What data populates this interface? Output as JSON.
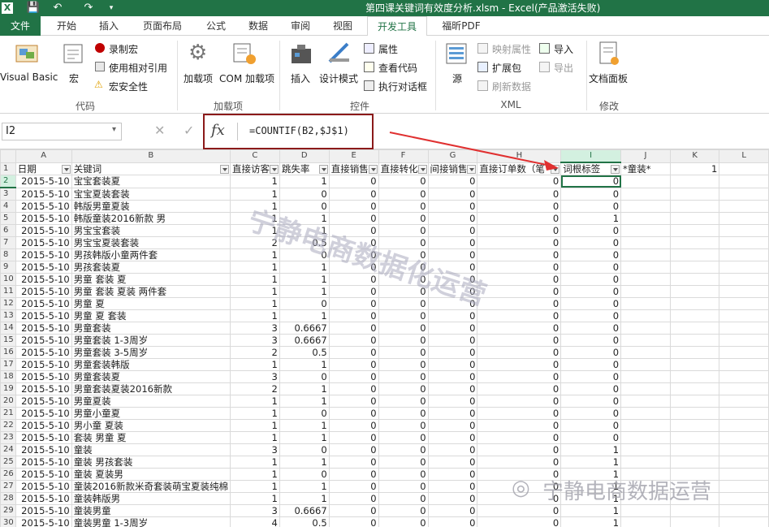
{
  "titlebar": {
    "title": "第四课关键词有效度分析.xlsm - Excel(产品激活失败)",
    "app_icon": "X"
  },
  "tabs": [
    "文件",
    "开始",
    "插入",
    "页面布局",
    "公式",
    "数据",
    "审阅",
    "视图",
    "开发工具",
    "福昕PDF"
  ],
  "ribbon": {
    "vb": "Visual Basic",
    "macro": "宏",
    "record": "录制宏",
    "relative": "使用相对引用",
    "security": "宏安全性",
    "g_code": "代码",
    "addin": "加载项",
    "com": "COM 加载项",
    "g_addin": "加载项",
    "insert": "插入",
    "design": "设计模式",
    "props": "属性",
    "viewcode": "查看代码",
    "rundialog": "执行对话框",
    "g_ctrl": "控件",
    "source": "源",
    "mapprops": "映射属性",
    "expand": "扩展包",
    "refresh": "刷新数据",
    "import": "导入",
    "export": "导出",
    "g_xml": "XML",
    "docpanel": "文档面板",
    "g_mod": "修改"
  },
  "formula_bar": {
    "cell": "I2",
    "formula": "=COUNTIF(B2,$J$1)",
    "fx": "fx",
    "cancel": "✕",
    "confirm": "✓"
  },
  "columns": [
    "A",
    "B",
    "C",
    "D",
    "E",
    "F",
    "G",
    "H",
    "I",
    "J",
    "K",
    "L"
  ],
  "headers": [
    "日期",
    "关键词",
    "直接访客",
    "跳失率",
    "直接销售",
    "直接转化",
    "间接销售",
    "直接订单数（笔",
    "词根标签",
    "*童装*",
    "1",
    ""
  ],
  "rows": [
    [
      "2015-5-10",
      "宝宝套装夏",
      "1",
      "1",
      "0",
      "0",
      "0",
      "0",
      "0"
    ],
    [
      "2015-5-10",
      "宝宝夏装套装",
      "1",
      "0",
      "0",
      "0",
      "0",
      "0",
      "0"
    ],
    [
      "2015-5-10",
      "韩版男童夏装",
      "1",
      "0",
      "0",
      "0",
      "0",
      "0",
      "0"
    ],
    [
      "2015-5-10",
      "韩版童装2016新款 男",
      "1",
      "1",
      "0",
      "0",
      "0",
      "0",
      "1"
    ],
    [
      "2015-5-10",
      "男宝宝套装",
      "1",
      "1",
      "0",
      "0",
      "0",
      "0",
      "0"
    ],
    [
      "2015-5-10",
      "男宝宝夏装套装",
      "2",
      "0.5",
      "0",
      "0",
      "0",
      "0",
      "0"
    ],
    [
      "2015-5-10",
      "男孩韩版小童两件套",
      "1",
      "0",
      "0",
      "0",
      "0",
      "0",
      "0"
    ],
    [
      "2015-5-10",
      "男孩套装夏",
      "1",
      "1",
      "0",
      "0",
      "0",
      "0",
      "0"
    ],
    [
      "2015-5-10",
      "男童 套装 夏",
      "1",
      "1",
      "0",
      "0",
      "0",
      "0",
      "0"
    ],
    [
      "2015-5-10",
      "男童 套装 夏装 两件套",
      "1",
      "1",
      "0",
      "0",
      "0",
      "0",
      "0"
    ],
    [
      "2015-5-10",
      "男童 夏",
      "1",
      "0",
      "0",
      "0",
      "0",
      "0",
      "0"
    ],
    [
      "2015-5-10",
      "男童 夏 套装",
      "1",
      "1",
      "0",
      "0",
      "0",
      "0",
      "0"
    ],
    [
      "2015-5-10",
      "男童套装",
      "3",
      "0.6667",
      "0",
      "0",
      "0",
      "0",
      "0"
    ],
    [
      "2015-5-10",
      "男童套装 1-3周岁",
      "3",
      "0.6667",
      "0",
      "0",
      "0",
      "0",
      "0"
    ],
    [
      "2015-5-10",
      "男童套装 3-5周岁",
      "2",
      "0.5",
      "0",
      "0",
      "0",
      "0",
      "0"
    ],
    [
      "2015-5-10",
      "男童套装韩版",
      "1",
      "1",
      "0",
      "0",
      "0",
      "0",
      "0"
    ],
    [
      "2015-5-10",
      "男童套装夏",
      "3",
      "0",
      "0",
      "0",
      "0",
      "0",
      "0"
    ],
    [
      "2015-5-10",
      "男童套装夏装2016新款",
      "2",
      "1",
      "0",
      "0",
      "0",
      "0",
      "0"
    ],
    [
      "2015-5-10",
      "男童夏装",
      "1",
      "1",
      "0",
      "0",
      "0",
      "0",
      "0"
    ],
    [
      "2015-5-10",
      "男童小童夏",
      "1",
      "0",
      "0",
      "0",
      "0",
      "0",
      "0"
    ],
    [
      "2015-5-10",
      "男小童 夏装",
      "1",
      "1",
      "0",
      "0",
      "0",
      "0",
      "0"
    ],
    [
      "2015-5-10",
      "套装 男童 夏",
      "1",
      "1",
      "0",
      "0",
      "0",
      "0",
      "0"
    ],
    [
      "2015-5-10",
      "童装",
      "3",
      "0",
      "0",
      "0",
      "0",
      "0",
      "1"
    ],
    [
      "2015-5-10",
      "童装 男孩套装",
      "1",
      "1",
      "0",
      "0",
      "0",
      "0",
      "1"
    ],
    [
      "2015-5-10",
      "童装 夏装男",
      "1",
      "0",
      "0",
      "0",
      "0",
      "0",
      "1"
    ],
    [
      "2015-5-10",
      "童装2016新款米奇套装萌宝夏装纯棉",
      "1",
      "1",
      "0",
      "0",
      "0",
      "0",
      "1"
    ],
    [
      "2015-5-10",
      "童装韩版男",
      "1",
      "1",
      "0",
      "0",
      "0",
      "0",
      "1"
    ],
    [
      "2015-5-10",
      "童装男童",
      "3",
      "0.6667",
      "0",
      "0",
      "0",
      "0",
      "1"
    ],
    [
      "2015-5-10",
      "童装男童 1-3周岁",
      "4",
      "0.5",
      "0",
      "0",
      "0",
      "0",
      "1"
    ]
  ],
  "watermarks": [
    "宁静电商数据化运营",
    "宁静电商数据运营"
  ],
  "colors": {
    "excel_green": "#217346",
    "highlight": "#8b1a1a",
    "arrow": "#e03030"
  }
}
